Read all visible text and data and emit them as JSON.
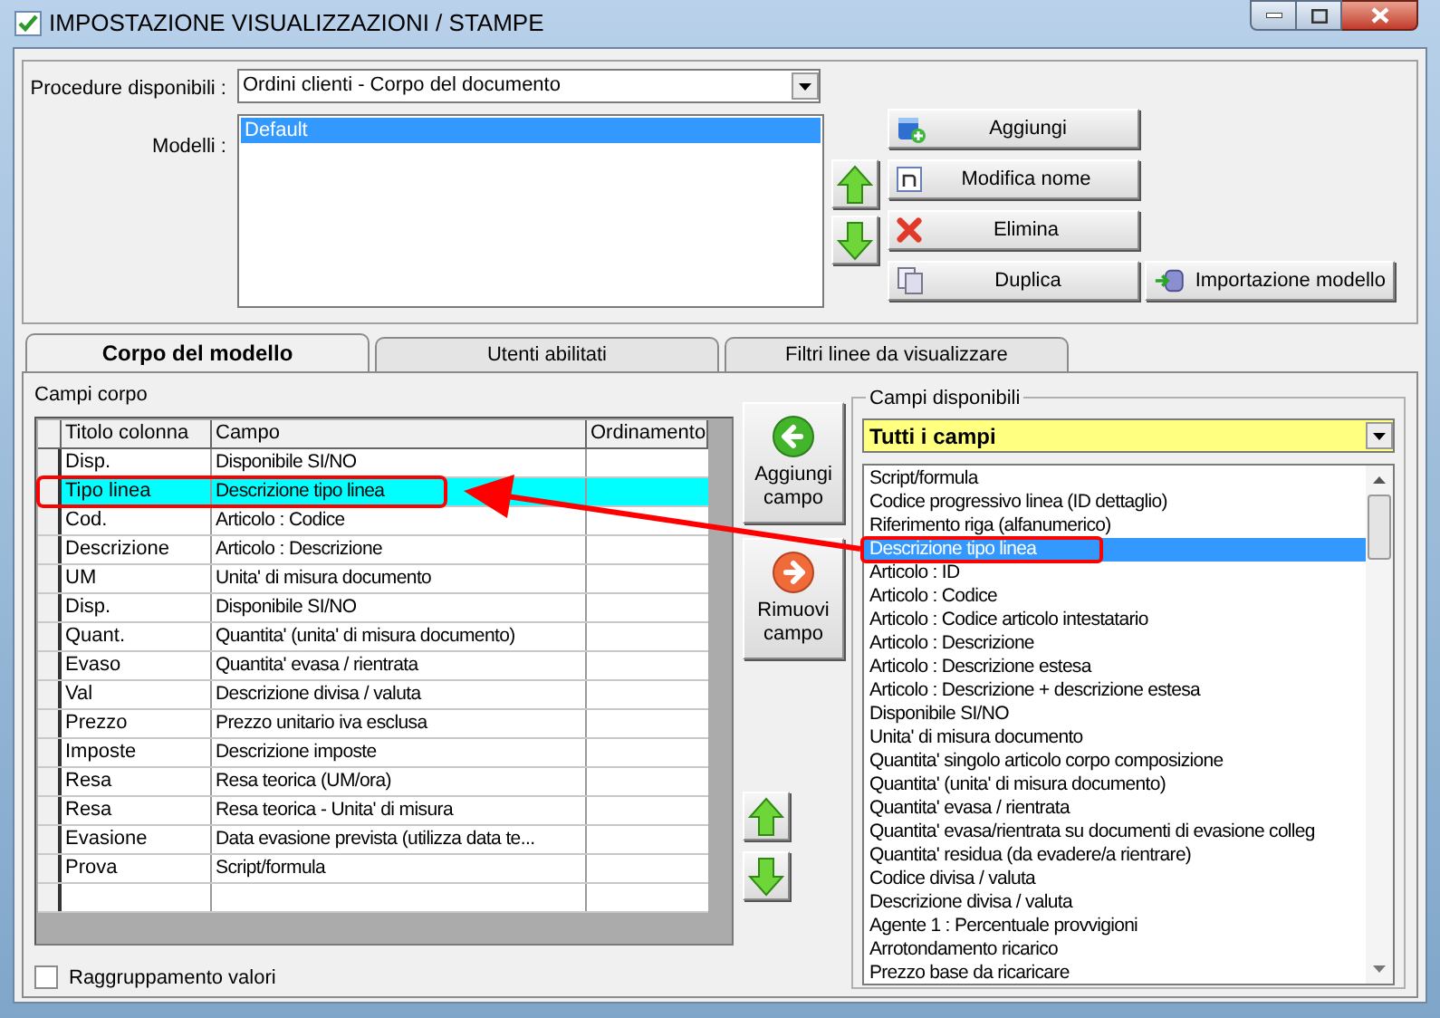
{
  "window": {
    "title": "IMPOSTAZIONE VISUALIZZAZIONI / STAMPE"
  },
  "procedure": {
    "label": "Procedure disponibili :",
    "value": "Ordini clienti - Corpo del documento"
  },
  "models": {
    "label": "Modelli :",
    "items": [
      {
        "text": "Default",
        "selected": true
      }
    ]
  },
  "model_buttons": [
    {
      "kind": "add",
      "label": "Aggiungi"
    },
    {
      "kind": "rename",
      "label": "Modifica nome"
    },
    {
      "kind": "delete",
      "label": "Elimina"
    },
    {
      "kind": "duplicate",
      "label": "Duplica"
    },
    {
      "kind": "import",
      "label": "Importazione modello"
    }
  ],
  "tabs": [
    {
      "label": "Corpo del modello",
      "selected": true
    },
    {
      "label": "Utenti abilitati",
      "selected": false
    },
    {
      "label": "Filtri linee da visualizzare",
      "selected": false
    }
  ],
  "body_fields": {
    "label": "Campi corpo",
    "columns": [
      "Titolo colonna",
      "Campo",
      "Ordinamento"
    ],
    "rows": [
      {
        "title": "Disp.",
        "field": "Disponibile SI/NO",
        "selected": false
      },
      {
        "title": "Tipo linea",
        "field": "Descrizione tipo linea",
        "selected": true
      },
      {
        "title": "Cod.",
        "field": "Articolo : Codice",
        "selected": false
      },
      {
        "title": "Descrizione",
        "field": "Articolo : Descrizione",
        "selected": false
      },
      {
        "title": "UM",
        "field": "Unita' di misura documento",
        "selected": false
      },
      {
        "title": "Disp.",
        "field": "Disponibile SI/NO",
        "selected": false
      },
      {
        "title": "Quant.",
        "field": "Quantita' (unita' di misura documento)",
        "selected": false
      },
      {
        "title": "Evaso",
        "field": "Quantita' evasa / rientrata",
        "selected": false
      },
      {
        "title": "Val",
        "field": "Descrizione divisa / valuta",
        "selected": false
      },
      {
        "title": "Prezzo",
        "field": "Prezzo unitario iva esclusa",
        "selected": false
      },
      {
        "title": "Imposte",
        "field": "Descrizione imposte",
        "selected": false
      },
      {
        "title": "Resa",
        "field": "Resa teorica (UM/ora)",
        "selected": false
      },
      {
        "title": "Resa",
        "field": "Resa teorica - Unita' di misura",
        "selected": false
      },
      {
        "title": "Evasione",
        "field": "Data evasione prevista (utilizza data te...",
        "selected": false
      },
      {
        "title": "Prova",
        "field": "Script/formula",
        "selected": false
      }
    ]
  },
  "field_buttons": [
    {
      "kind": "add",
      "label": "Aggiungi campo"
    },
    {
      "kind": "remove",
      "label": "Rimuovi campo"
    }
  ],
  "grouping": {
    "label": "Raggruppamento valori",
    "checked": false
  },
  "available_fields": {
    "label": "Campi disponibili",
    "filter": "Tutti i campi",
    "items": [
      {
        "text": "Script/formula",
        "selected": false
      },
      {
        "text": "Codice progressivo linea (ID dettaglio)",
        "selected": false
      },
      {
        "text": "Riferimento riga (alfanumerico)",
        "selected": false
      },
      {
        "text": "Descrizione tipo linea",
        "selected": true
      },
      {
        "text": "Articolo : ID",
        "selected": false
      },
      {
        "text": "Articolo : Codice",
        "selected": false
      },
      {
        "text": "Articolo : Codice articolo intestatario",
        "selected": false
      },
      {
        "text": "Articolo : Descrizione",
        "selected": false
      },
      {
        "text": "Articolo : Descrizione estesa",
        "selected": false
      },
      {
        "text": "Articolo : Descrizione + descrizione estesa",
        "selected": false
      },
      {
        "text": "Disponibile SI/NO",
        "selected": false
      },
      {
        "text": "Unita' di misura documento",
        "selected": false
      },
      {
        "text": "Quantita' singolo articolo corpo composizione",
        "selected": false
      },
      {
        "text": "Quantita' (unita' di misura documento)",
        "selected": false
      },
      {
        "text": "Quantita' evasa / rientrata",
        "selected": false
      },
      {
        "text": "Quantita' evasa/rientrata su documenti di evasione colleg",
        "selected": false
      },
      {
        "text": "Quantita' residua (da evadere/a rientrare)",
        "selected": false
      },
      {
        "text": "Codice divisa / valuta",
        "selected": false
      },
      {
        "text": "Descrizione divisa / valuta",
        "selected": false
      },
      {
        "text": "Agente 1 : Percentuale provvigioni",
        "selected": false
      },
      {
        "text": "Arrotondamento ricarico",
        "selected": false
      },
      {
        "text": "Prezzo base da ricaricare",
        "selected": false
      }
    ]
  }
}
